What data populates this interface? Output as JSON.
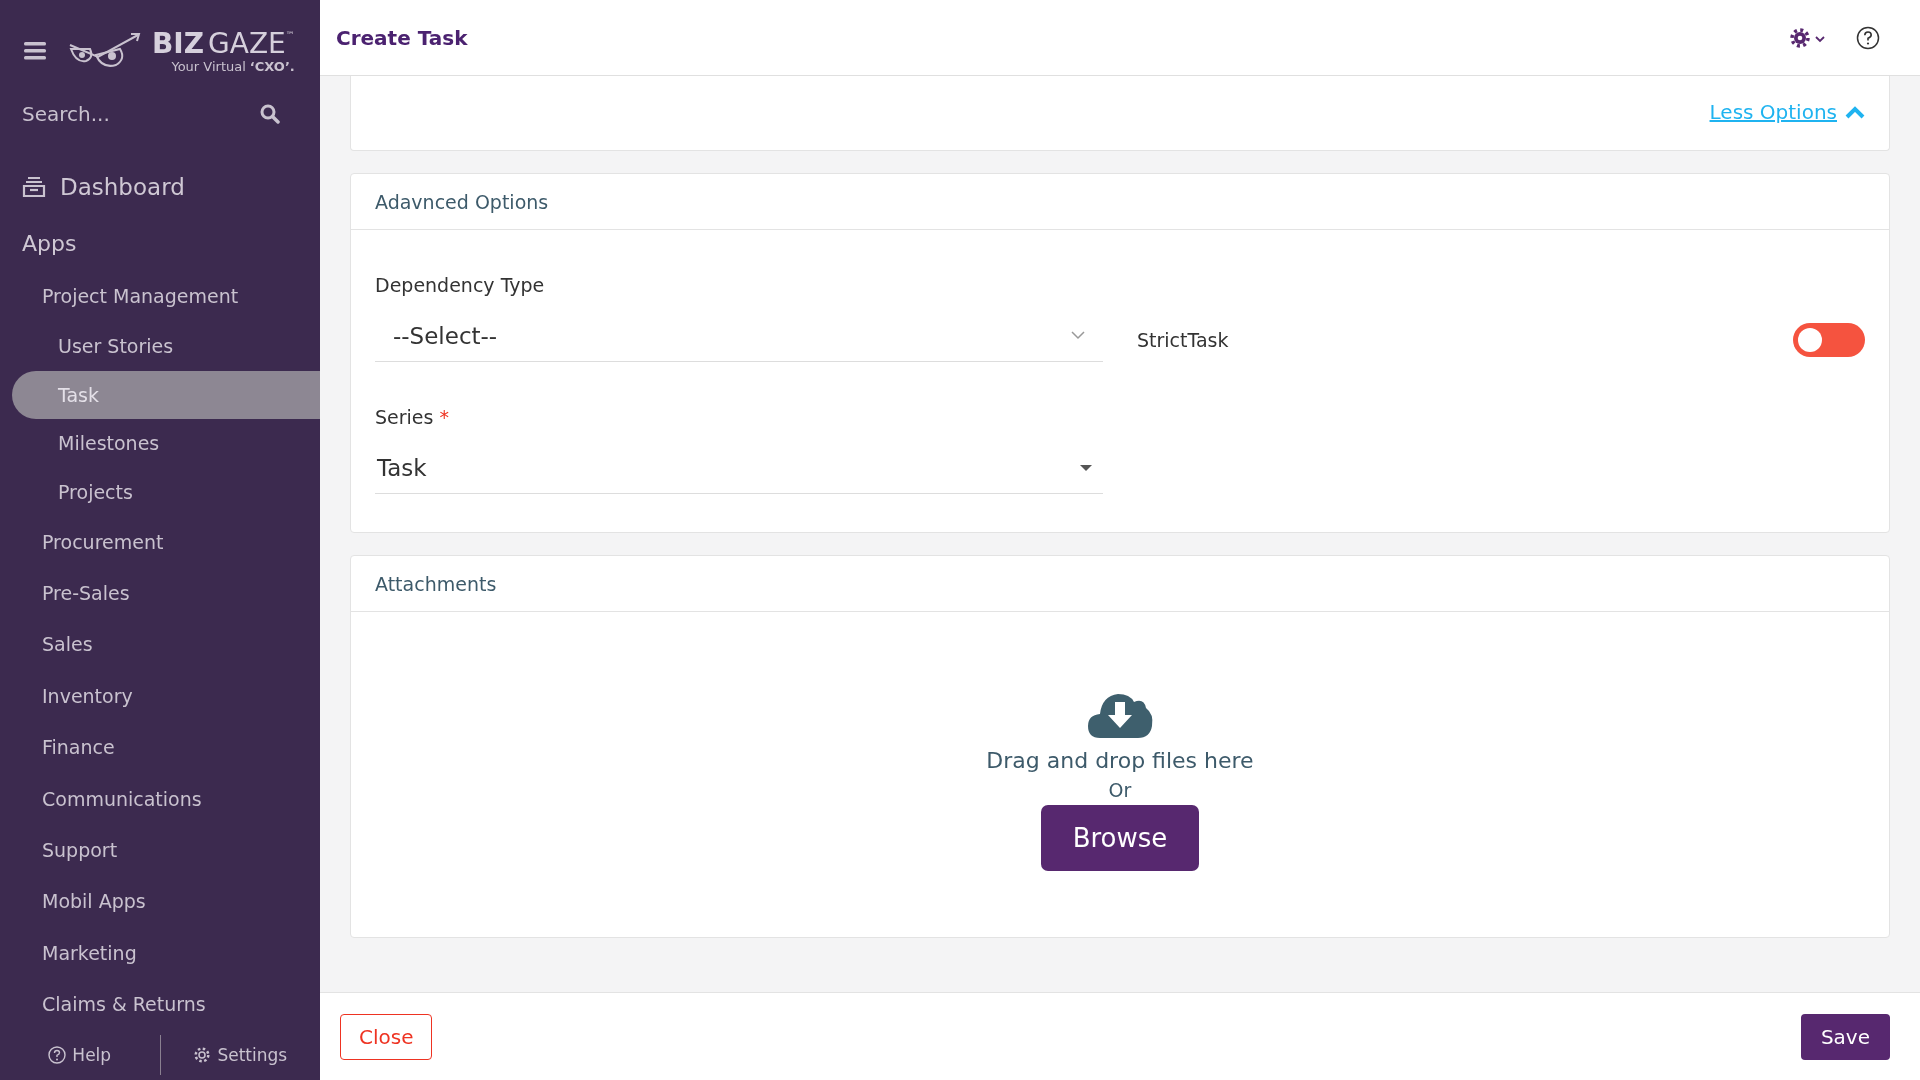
{
  "sidebar": {
    "logo": {
      "word_1": "BIZ",
      "word_2": "GAZE",
      "trademark": "™",
      "tagline": "Your Virtual",
      "tagline_bold": "‘CXO’."
    },
    "search": {
      "placeholder": "Search..."
    },
    "dashboard": "Dashboard",
    "section": "Apps",
    "items": [
      {
        "label": "Project Management",
        "selected": false,
        "children": [
          {
            "label": "User Stories",
            "selected": false
          },
          {
            "label": "Task",
            "selected": true
          },
          {
            "label": "Milestones",
            "selected": false
          },
          {
            "label": "Projects",
            "selected": false
          }
        ]
      },
      {
        "label": "Procurement",
        "selected": false
      },
      {
        "label": "Pre-Sales",
        "selected": false
      },
      {
        "label": "Sales",
        "selected": false
      },
      {
        "label": "Inventory",
        "selected": false
      },
      {
        "label": "Finance",
        "selected": false
      },
      {
        "label": "Communications",
        "selected": false
      },
      {
        "label": "Support",
        "selected": false
      },
      {
        "label": "Mobil Apps",
        "selected": false
      },
      {
        "label": "Marketing",
        "selected": false
      },
      {
        "label": "Claims & Returns",
        "selected": false
      }
    ],
    "footer": {
      "help": "Help",
      "settings": "Settings"
    }
  },
  "header": {
    "title": "Create Task"
  },
  "options_link": "Less Options",
  "advanced": {
    "title": "Adavnced Options",
    "dependency_label": "Dependency Type",
    "dependency_value": "--Select--",
    "strict_label": "StrictTask",
    "strict_on": false,
    "series_label": "Series",
    "series_required_mark": "*",
    "series_value": "Task"
  },
  "attachments": {
    "title": "Attachments",
    "drop_text": "Drag and drop files here",
    "or": "Or",
    "browse": "Browse"
  },
  "buttons": {
    "close": "Close",
    "save": "Save"
  }
}
